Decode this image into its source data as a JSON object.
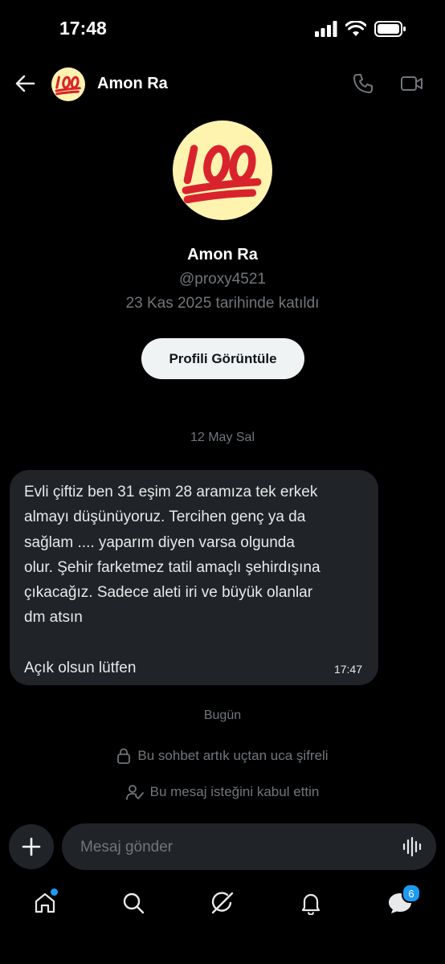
{
  "status_bar": {
    "time": "17:48"
  },
  "header": {
    "contact_name": "Amon Ra",
    "avatar_emoji": "100",
    "icons": [
      "back-arrow-icon",
      "phone-icon",
      "video-icon"
    ]
  },
  "profile": {
    "name": "Amon Ra",
    "handle": "@proxy4521",
    "joined": "23 Kas 2025 tarihinde katıldı",
    "view_profile_label": "Profili Görüntüle"
  },
  "conversation": {
    "date_separator": "12 May Sal",
    "messages": [
      {
        "text": "Evli çiftiz ben 31 eşim 28 aramıza tek erkek\nalmayı düşünüyoruz. Tercihen genç ya da\nsağlam .... yaparım diyen varsa olgunda\nolur. Şehir farketmez tatil amaçlı şehirdışına\nçıkacağız. Sadece aleti iri ve büyük olanlar\ndm atsın\n\nAçık olsun lütfen",
        "time": "17:47"
      }
    ],
    "today_separator": "Bugün",
    "info_encrypted": "Bu sohbet artık uçtan uca şifreli",
    "info_accepted": "Bu mesaj isteğini kabul ettin"
  },
  "composer": {
    "placeholder": "Mesaj gönder"
  },
  "bottom_nav": {
    "items": [
      "home-icon",
      "search-icon",
      "grok-icon",
      "notifications-icon",
      "messages-icon"
    ],
    "messages_badge": "6"
  },
  "colors": {
    "background": "#000000",
    "bubble": "#202327",
    "muted_text": "#71767b",
    "accent": "#1d9bf0",
    "emoji_red": "#d9232c"
  }
}
